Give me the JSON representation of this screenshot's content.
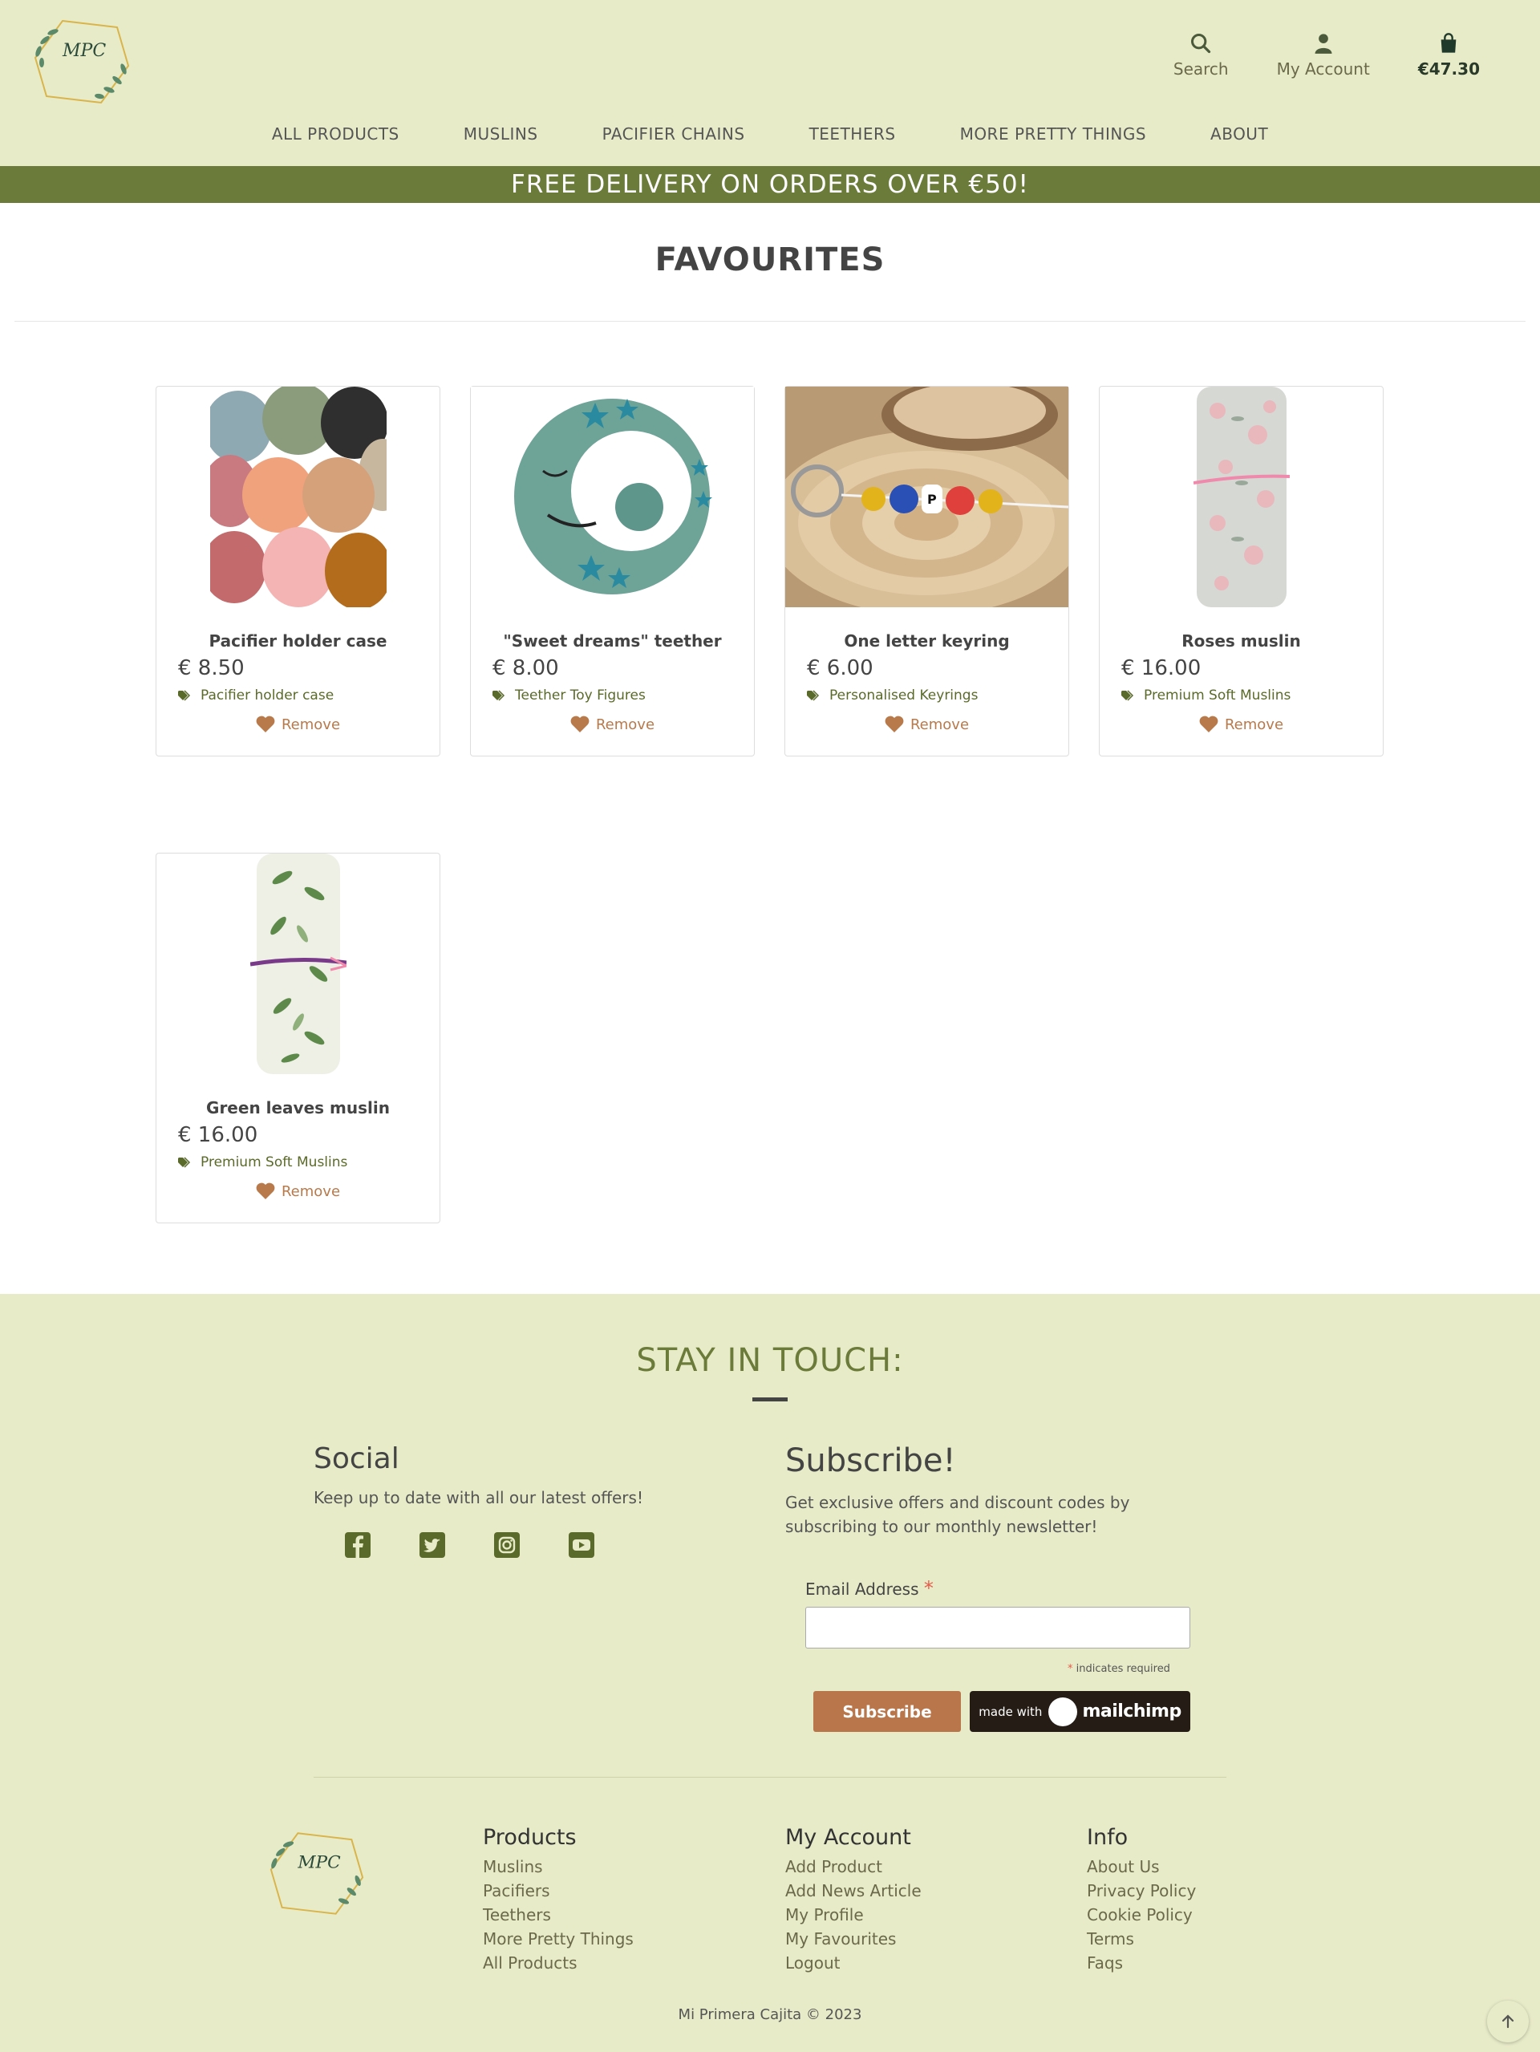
{
  "header": {
    "logo_text": "MPC",
    "search_label": "Search",
    "account_label": "My Account",
    "cart_total": "€47.30"
  },
  "nav": {
    "items": [
      "ALL PRODUCTS",
      "MUSLINS",
      "PACIFIER CHAINS",
      "TEETHERS",
      "MORE PRETTY THINGS",
      "ABOUT"
    ]
  },
  "banner": "FREE DELIVERY ON ORDERS OVER €50!",
  "page_title": "FAVOURITES",
  "products": [
    {
      "name": "Pacifier holder case",
      "price": "€ 8.50",
      "tag": "Pacifier holder case",
      "remove": "Remove"
    },
    {
      "name": "\"Sweet dreams\" teether",
      "price": "€ 8.00",
      "tag": "Teether Toy Figures",
      "remove": "Remove"
    },
    {
      "name": "One letter keyring",
      "price": "€ 6.00",
      "tag": "Personalised Keyrings",
      "remove": "Remove"
    },
    {
      "name": "Roses muslin",
      "price": "€ 16.00",
      "tag": "Premium Soft Muslins",
      "remove": "Remove"
    },
    {
      "name": "Green leaves muslin",
      "price": "€ 16.00",
      "tag": "Premium Soft Muslins",
      "remove": "Remove"
    }
  ],
  "footer": {
    "stay_in_touch": "STAY IN TOUCH:",
    "social_title": "Social",
    "social_text": "Keep up to date with all our latest offers!",
    "subscribe_title": "Subscribe!",
    "subscribe_text": "Get exclusive offers and discount codes by subscribing to our monthly newsletter!",
    "email_label": "Email Address",
    "required_star": "*",
    "indicates_required": "indicates required",
    "subscribe_button": "Subscribe",
    "made_with": "made with",
    "mailchimp": "mailchimp",
    "products_title": "Products",
    "products_links": [
      "Muslins",
      "Pacifiers",
      "Teethers",
      "More Pretty Things",
      "All Products"
    ],
    "account_title": "My Account",
    "account_links": [
      "Add Product",
      "Add News Article",
      "My Profile",
      "My Favourites",
      "Logout"
    ],
    "info_title": "Info",
    "info_links": [
      "About Us",
      "Privacy Policy",
      "Cookie Policy",
      "Terms",
      "Faqs"
    ],
    "copyright": "Mi Primera Cajita © 2023"
  },
  "colors": {
    "header_bg": "#e8ebc8",
    "banner_bg": "#6b7b3a",
    "accent_brown": "#b87a4b",
    "tag_green": "#5a6a2a"
  }
}
